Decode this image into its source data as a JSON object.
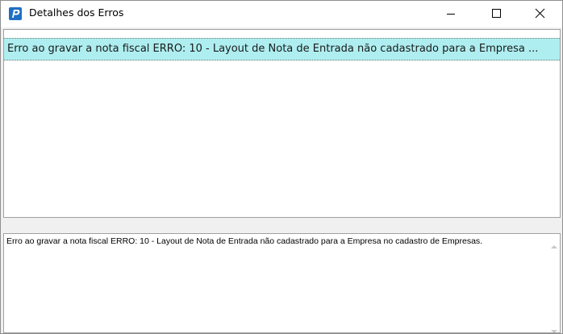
{
  "window": {
    "title": "Detalhes dos Erros"
  },
  "titlebar": {
    "icon": "app-logo-icon",
    "buttons": [
      "minimize-icon",
      "maximize-icon",
      "close-icon"
    ]
  },
  "error_list": {
    "rows": [
      {
        "text": "Erro ao gravar a nota fiscal ERRO: 10 - Layout de Nota de Entrada não cadastrado para a Empresa ..."
      }
    ]
  },
  "detail": {
    "text": "Erro ao gravar a nota fiscal ERRO: 10 - Layout de Nota de Entrada não cadastrado para a Empresa        no cadastro de Empresas."
  },
  "colors": {
    "selected_row": "#aeeef0",
    "app_icon": "#1e6fc4"
  }
}
